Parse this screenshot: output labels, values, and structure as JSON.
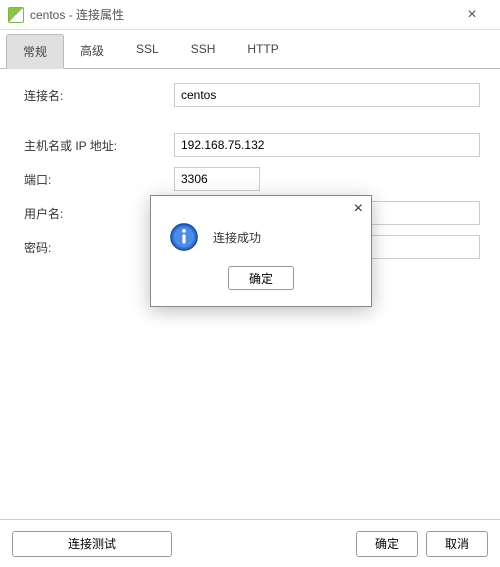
{
  "window": {
    "title": "centos - 连接属性"
  },
  "tabs": [
    {
      "label": "常规",
      "active": true
    },
    {
      "label": "高级"
    },
    {
      "label": "SSL"
    },
    {
      "label": "SSH"
    },
    {
      "label": "HTTP"
    }
  ],
  "form": {
    "connection_name_label": "连接名:",
    "connection_name_value": "centos",
    "host_label": "主机名或 IP 地址:",
    "host_value": "192.168.75.132",
    "port_label": "端口:",
    "port_value": "3306",
    "username_label": "用户名:",
    "username_value": "",
    "password_label": "密码:",
    "password_value": ""
  },
  "footer": {
    "test_label": "连接测试",
    "ok_label": "确定",
    "cancel_label": "取消"
  },
  "dialog": {
    "message": "连接成功",
    "ok_label": "确定"
  }
}
